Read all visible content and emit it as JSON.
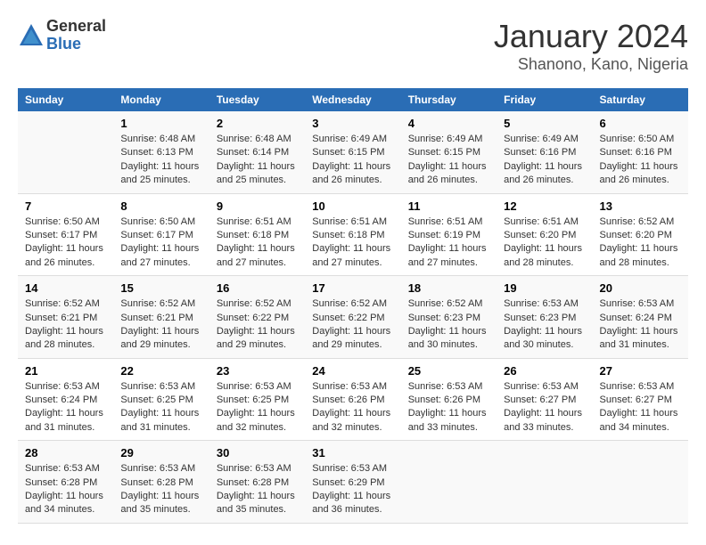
{
  "header": {
    "logo_general": "General",
    "logo_blue": "Blue",
    "title": "January 2024",
    "subtitle": "Shanono, Kano, Nigeria"
  },
  "days_of_week": [
    "Sunday",
    "Monday",
    "Tuesday",
    "Wednesday",
    "Thursday",
    "Friday",
    "Saturday"
  ],
  "weeks": [
    [
      {
        "day": "",
        "info": ""
      },
      {
        "day": "1",
        "sunrise": "Sunrise: 6:48 AM",
        "sunset": "Sunset: 6:13 PM",
        "daylight": "Daylight: 11 hours and 25 minutes."
      },
      {
        "day": "2",
        "sunrise": "Sunrise: 6:48 AM",
        "sunset": "Sunset: 6:14 PM",
        "daylight": "Daylight: 11 hours and 25 minutes."
      },
      {
        "day": "3",
        "sunrise": "Sunrise: 6:49 AM",
        "sunset": "Sunset: 6:15 PM",
        "daylight": "Daylight: 11 hours and 26 minutes."
      },
      {
        "day": "4",
        "sunrise": "Sunrise: 6:49 AM",
        "sunset": "Sunset: 6:15 PM",
        "daylight": "Daylight: 11 hours and 26 minutes."
      },
      {
        "day": "5",
        "sunrise": "Sunrise: 6:49 AM",
        "sunset": "Sunset: 6:16 PM",
        "daylight": "Daylight: 11 hours and 26 minutes."
      },
      {
        "day": "6",
        "sunrise": "Sunrise: 6:50 AM",
        "sunset": "Sunset: 6:16 PM",
        "daylight": "Daylight: 11 hours and 26 minutes."
      }
    ],
    [
      {
        "day": "7",
        "sunrise": "Sunrise: 6:50 AM",
        "sunset": "Sunset: 6:17 PM",
        "daylight": "Daylight: 11 hours and 26 minutes."
      },
      {
        "day": "8",
        "sunrise": "Sunrise: 6:50 AM",
        "sunset": "Sunset: 6:17 PM",
        "daylight": "Daylight: 11 hours and 27 minutes."
      },
      {
        "day": "9",
        "sunrise": "Sunrise: 6:51 AM",
        "sunset": "Sunset: 6:18 PM",
        "daylight": "Daylight: 11 hours and 27 minutes."
      },
      {
        "day": "10",
        "sunrise": "Sunrise: 6:51 AM",
        "sunset": "Sunset: 6:18 PM",
        "daylight": "Daylight: 11 hours and 27 minutes."
      },
      {
        "day": "11",
        "sunrise": "Sunrise: 6:51 AM",
        "sunset": "Sunset: 6:19 PM",
        "daylight": "Daylight: 11 hours and 27 minutes."
      },
      {
        "day": "12",
        "sunrise": "Sunrise: 6:51 AM",
        "sunset": "Sunset: 6:20 PM",
        "daylight": "Daylight: 11 hours and 28 minutes."
      },
      {
        "day": "13",
        "sunrise": "Sunrise: 6:52 AM",
        "sunset": "Sunset: 6:20 PM",
        "daylight": "Daylight: 11 hours and 28 minutes."
      }
    ],
    [
      {
        "day": "14",
        "sunrise": "Sunrise: 6:52 AM",
        "sunset": "Sunset: 6:21 PM",
        "daylight": "Daylight: 11 hours and 28 minutes."
      },
      {
        "day": "15",
        "sunrise": "Sunrise: 6:52 AM",
        "sunset": "Sunset: 6:21 PM",
        "daylight": "Daylight: 11 hours and 29 minutes."
      },
      {
        "day": "16",
        "sunrise": "Sunrise: 6:52 AM",
        "sunset": "Sunset: 6:22 PM",
        "daylight": "Daylight: 11 hours and 29 minutes."
      },
      {
        "day": "17",
        "sunrise": "Sunrise: 6:52 AM",
        "sunset": "Sunset: 6:22 PM",
        "daylight": "Daylight: 11 hours and 29 minutes."
      },
      {
        "day": "18",
        "sunrise": "Sunrise: 6:52 AM",
        "sunset": "Sunset: 6:23 PM",
        "daylight": "Daylight: 11 hours and 30 minutes."
      },
      {
        "day": "19",
        "sunrise": "Sunrise: 6:53 AM",
        "sunset": "Sunset: 6:23 PM",
        "daylight": "Daylight: 11 hours and 30 minutes."
      },
      {
        "day": "20",
        "sunrise": "Sunrise: 6:53 AM",
        "sunset": "Sunset: 6:24 PM",
        "daylight": "Daylight: 11 hours and 31 minutes."
      }
    ],
    [
      {
        "day": "21",
        "sunrise": "Sunrise: 6:53 AM",
        "sunset": "Sunset: 6:24 PM",
        "daylight": "Daylight: 11 hours and 31 minutes."
      },
      {
        "day": "22",
        "sunrise": "Sunrise: 6:53 AM",
        "sunset": "Sunset: 6:25 PM",
        "daylight": "Daylight: 11 hours and 31 minutes."
      },
      {
        "day": "23",
        "sunrise": "Sunrise: 6:53 AM",
        "sunset": "Sunset: 6:25 PM",
        "daylight": "Daylight: 11 hours and 32 minutes."
      },
      {
        "day": "24",
        "sunrise": "Sunrise: 6:53 AM",
        "sunset": "Sunset: 6:26 PM",
        "daylight": "Daylight: 11 hours and 32 minutes."
      },
      {
        "day": "25",
        "sunrise": "Sunrise: 6:53 AM",
        "sunset": "Sunset: 6:26 PM",
        "daylight": "Daylight: 11 hours and 33 minutes."
      },
      {
        "day": "26",
        "sunrise": "Sunrise: 6:53 AM",
        "sunset": "Sunset: 6:27 PM",
        "daylight": "Daylight: 11 hours and 33 minutes."
      },
      {
        "day": "27",
        "sunrise": "Sunrise: 6:53 AM",
        "sunset": "Sunset: 6:27 PM",
        "daylight": "Daylight: 11 hours and 34 minutes."
      }
    ],
    [
      {
        "day": "28",
        "sunrise": "Sunrise: 6:53 AM",
        "sunset": "Sunset: 6:28 PM",
        "daylight": "Daylight: 11 hours and 34 minutes."
      },
      {
        "day": "29",
        "sunrise": "Sunrise: 6:53 AM",
        "sunset": "Sunset: 6:28 PM",
        "daylight": "Daylight: 11 hours and 35 minutes."
      },
      {
        "day": "30",
        "sunrise": "Sunrise: 6:53 AM",
        "sunset": "Sunset: 6:28 PM",
        "daylight": "Daylight: 11 hours and 35 minutes."
      },
      {
        "day": "31",
        "sunrise": "Sunrise: 6:53 AM",
        "sunset": "Sunset: 6:29 PM",
        "daylight": "Daylight: 11 hours and 36 minutes."
      },
      {
        "day": "",
        "info": ""
      },
      {
        "day": "",
        "info": ""
      },
      {
        "day": "",
        "info": ""
      }
    ]
  ]
}
